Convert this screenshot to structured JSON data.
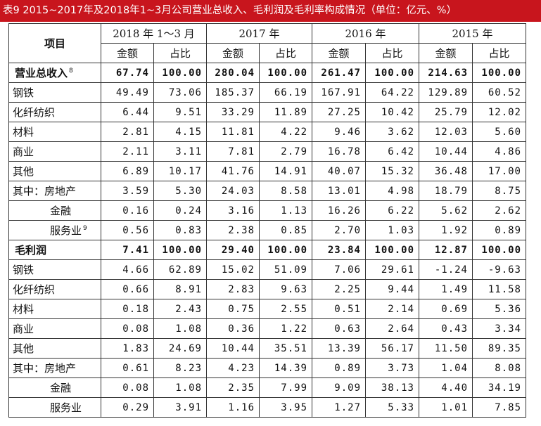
{
  "title": "表9  2015~2017年及2018年1~3月公司营业总收入、毛利润及毛利率构成情况（单位：亿元、%）",
  "header": {
    "item": "项目",
    "periods": [
      "2018 年 1～3 月",
      "2017 年",
      "2016 年",
      "2015 年"
    ],
    "amount": "金额",
    "ratio": "占比"
  },
  "rows": [
    {
      "label": "营业总收入",
      "sup": "8",
      "total": true,
      "values": [
        "67.74",
        "100.00",
        "280.04",
        "100.00",
        "261.47",
        "100.00",
        "214.63",
        "100.00"
      ]
    },
    {
      "label": "钢铁",
      "values": [
        "49.49",
        "73.06",
        "185.37",
        "66.19",
        "167.91",
        "64.22",
        "129.89",
        "60.52"
      ]
    },
    {
      "label": "化纤纺织",
      "values": [
        "6.44",
        "9.51",
        "33.29",
        "11.89",
        "27.25",
        "10.42",
        "25.79",
        "12.02"
      ]
    },
    {
      "label": "材料",
      "values": [
        "2.81",
        "4.15",
        "11.81",
        "4.22",
        "9.46",
        "3.62",
        "12.03",
        "5.60"
      ]
    },
    {
      "label": "商业",
      "values": [
        "2.11",
        "3.11",
        "7.81",
        "2.79",
        "16.78",
        "6.42",
        "10.44",
        "4.86"
      ]
    },
    {
      "label": "其他",
      "values": [
        "6.89",
        "10.17",
        "41.76",
        "14.91",
        "40.07",
        "15.32",
        "36.48",
        "17.00"
      ]
    },
    {
      "label": "其中：房地产",
      "values": [
        "3.59",
        "5.30",
        "24.03",
        "8.58",
        "13.01",
        "4.98",
        "18.79",
        "8.75"
      ]
    },
    {
      "label": "金融",
      "indent": true,
      "values": [
        "0.16",
        "0.24",
        "3.16",
        "1.13",
        "16.26",
        "6.22",
        "5.62",
        "2.62"
      ]
    },
    {
      "label": "服务业",
      "sup": "9",
      "indent": true,
      "values": [
        "0.56",
        "0.83",
        "2.38",
        "0.85",
        "2.70",
        "1.03",
        "1.92",
        "0.89"
      ]
    },
    {
      "label": "毛利润",
      "total": true,
      "values": [
        "7.41",
        "100.00",
        "29.40",
        "100.00",
        "23.84",
        "100.00",
        "12.87",
        "100.00"
      ]
    },
    {
      "label": "钢铁",
      "values": [
        "4.66",
        "62.89",
        "15.02",
        "51.09",
        "7.06",
        "29.61",
        "-1.24",
        "-9.63"
      ]
    },
    {
      "label": "化纤纺织",
      "values": [
        "0.66",
        "8.91",
        "2.83",
        "9.63",
        "2.25",
        "9.44",
        "1.49",
        "11.58"
      ]
    },
    {
      "label": "材料",
      "values": [
        "0.18",
        "2.43",
        "0.75",
        "2.55",
        "0.51",
        "2.14",
        "0.69",
        "5.36"
      ]
    },
    {
      "label": "商业",
      "values": [
        "0.08",
        "1.08",
        "0.36",
        "1.22",
        "0.63",
        "2.64",
        "0.43",
        "3.34"
      ]
    },
    {
      "label": "其他",
      "values": [
        "1.83",
        "24.69",
        "10.44",
        "35.51",
        "13.39",
        "56.17",
        "11.50",
        "89.35"
      ]
    },
    {
      "label": "其中：房地产",
      "values": [
        "0.61",
        "8.23",
        "4.23",
        "14.39",
        "0.89",
        "3.73",
        "1.04",
        "8.08"
      ]
    },
    {
      "label": "金融",
      "indent": true,
      "values": [
        "0.08",
        "1.08",
        "2.35",
        "7.99",
        "9.09",
        "38.13",
        "4.40",
        "34.19"
      ]
    },
    {
      "label": "服务业",
      "indent": true,
      "values": [
        "0.29",
        "3.91",
        "1.16",
        "3.95",
        "1.27",
        "5.33",
        "1.01",
        "7.85"
      ]
    }
  ]
}
